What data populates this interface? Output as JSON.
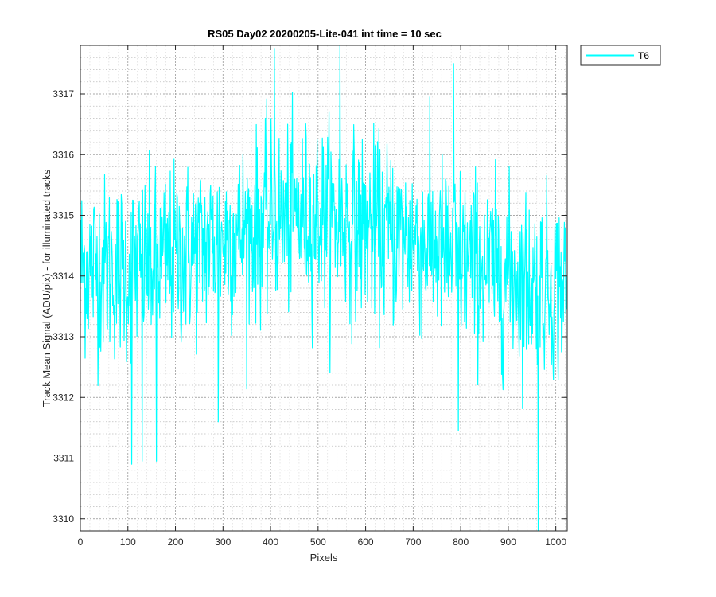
{
  "chart_data": {
    "type": "line",
    "title": "RS05 Day02 20200205-Lite-041 int time = 10 sec",
    "xlabel": "Pixels",
    "ylabel": "Track Mean Signal (ADU/pix) - for illuminated tracks",
    "xlim": [
      0,
      1024
    ],
    "ylim": [
      3309.8,
      3317.8
    ],
    "x_ticks": [
      0,
      100,
      200,
      300,
      400,
      500,
      600,
      700,
      800,
      900,
      1000
    ],
    "y_ticks": [
      3310,
      3311,
      3312,
      3313,
      3314,
      3315,
      3316,
      3317
    ],
    "grid": true,
    "minor_grid": true,
    "legend_position": "outside-top-right",
    "series": [
      {
        "name": "T6",
        "color": "#00FFFF",
        "points": 1024,
        "profile_x": [
          0,
          100,
          200,
          300,
          400,
          500,
          600,
          700,
          800,
          900,
          1024
        ],
        "profile_mean": [
          3314.2,
          3314.1,
          3314.3,
          3314.6,
          3314.9,
          3315.0,
          3314.8,
          3314.6,
          3314.3,
          3314.0,
          3313.8
        ],
        "peaks": [
          {
            "x": 108,
            "y": 3310.9
          },
          {
            "x": 130,
            "y": 3310.95
          },
          {
            "x": 160,
            "y": 3310.95
          },
          {
            "x": 290,
            "y": 3311.6
          },
          {
            "x": 408,
            "y": 3317.75
          },
          {
            "x": 546,
            "y": 3317.8
          },
          {
            "x": 785,
            "y": 3317.5
          },
          {
            "x": 795,
            "y": 3311.45
          },
          {
            "x": 963,
            "y": 3309.8
          }
        ]
      }
    ]
  }
}
